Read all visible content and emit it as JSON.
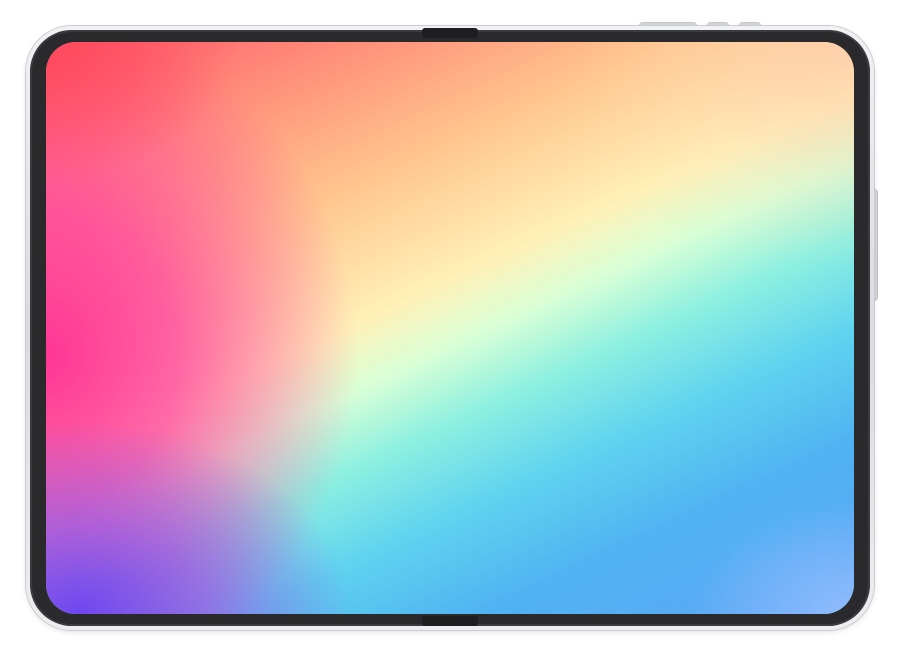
{
  "scene": {
    "subject": "foldable-tablet",
    "wallpaper_colors": [
      "#ff5a6e",
      "#ff2e96",
      "#ffc48e",
      "#fff1b8",
      "#8ef0e0",
      "#4fb2f2",
      "#6e46f0"
    ],
    "frame_color": "#e3e5e8",
    "bezel_color": "#2a2a2c"
  }
}
